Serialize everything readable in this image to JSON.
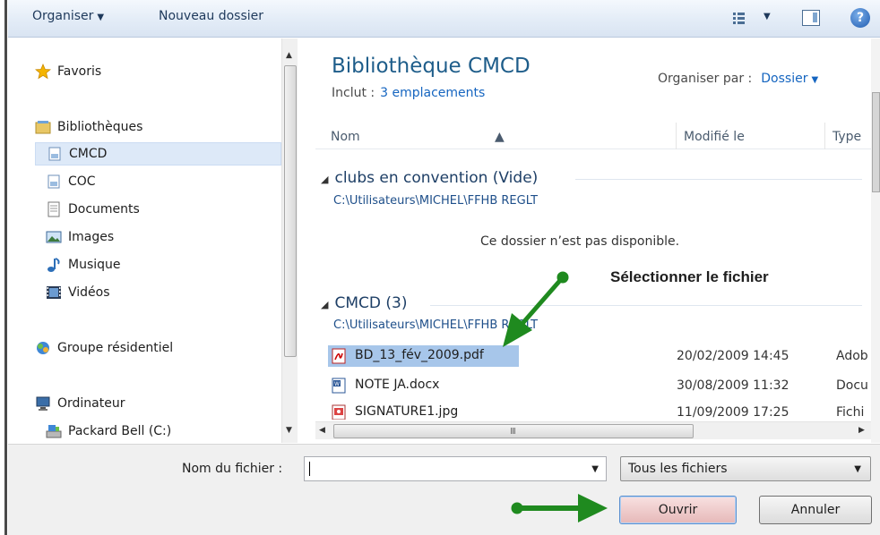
{
  "toolbar": {
    "organise_label": "Organiser",
    "new_folder_label": "Nouveau dossier",
    "view_icon": "view-options-icon",
    "pane_icon": "preview-pane-icon",
    "help_icon": "help-icon",
    "help_label": "?"
  },
  "nav": {
    "favorites": "Favoris",
    "libraries": "Bibliothèques",
    "library_items": [
      "CMCD",
      "COC",
      "Documents",
      "Images",
      "Musique",
      "Vidéos"
    ],
    "homegroup": "Groupe résidentiel",
    "computer": "Ordinateur",
    "drive": "Packard Bell (C:)",
    "selected": "CMCD"
  },
  "main": {
    "title": "Bibliothèque CMCD",
    "includes_label": "Inclut :",
    "includes_link": "3 emplacements",
    "arrange_label": "Organiser par :",
    "arrange_value": "Dossier",
    "columns": {
      "name": "Nom",
      "modified": "Modifié le",
      "type": "Type"
    },
    "groups": [
      {
        "name": "clubs en convention (Vide)",
        "path": "C:\\Utilisateurs\\MICHEL\\FFHB REGLT",
        "empty_message": "Ce dossier n’est pas disponible."
      },
      {
        "name": "CMCD (3)",
        "path": "C:\\Utilisateurs\\MICHEL\\FFHB REGLT",
        "files": [
          {
            "name": "BD_13_fév_2009.pdf",
            "modified": "20/02/2009 14:45",
            "type": "Adob",
            "icon": "pdf-file-icon"
          },
          {
            "name": "NOTE JA.docx",
            "modified": "30/08/2009 11:32",
            "type": "Docu",
            "icon": "word-file-icon"
          },
          {
            "name": "SIGNATURE1.jpg",
            "modified": "11/09/2009 17:25",
            "type": "Fichi",
            "icon": "image-file-icon"
          }
        ]
      }
    ],
    "selected_file": "BD_13_fév_2009.pdf"
  },
  "bottom": {
    "filename_label": "Nom du fichier :",
    "filename_value": "",
    "filter_value": "Tous les fichiers",
    "open_label": "Ouvrir",
    "cancel_label": "Annuler"
  },
  "annotation": {
    "text": "Sélectionner le fichier",
    "color": "#1f8a1f"
  },
  "colors": {
    "title_blue": "#1e5d8a",
    "link_blue": "#1565c0",
    "selection": "#a7c6ea",
    "arrow_green": "#1f8a1f"
  }
}
